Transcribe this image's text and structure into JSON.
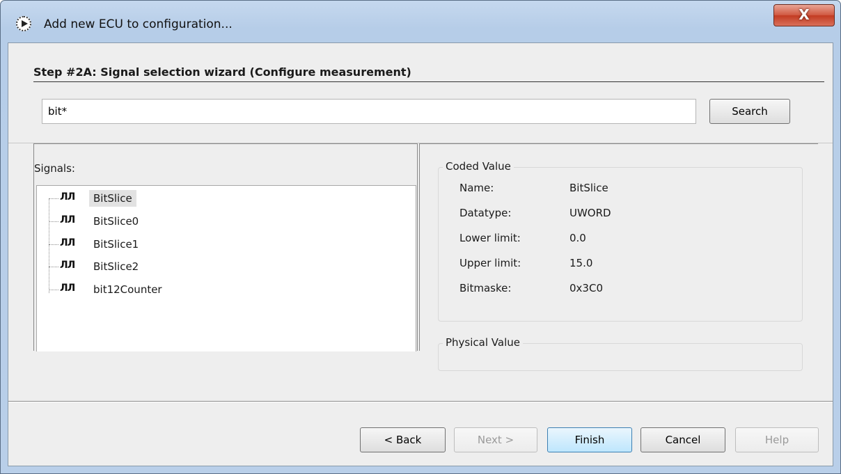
{
  "window": {
    "title": "Add new ECU to configuration...",
    "close_label": "X"
  },
  "step": {
    "title": "Step #2A: Signal selection wizard (Configure measurement)"
  },
  "search": {
    "value": "bit*",
    "button_label": "Search"
  },
  "signals": {
    "label": "Signals:",
    "icon": "signal-pulse-icon",
    "icon_glyph": "ЛЛ",
    "items": [
      {
        "label": "BitSlice",
        "selected": true
      },
      {
        "label": "BitSlice0"
      },
      {
        "label": "BitSlice1"
      },
      {
        "label": "BitSlice2"
      },
      {
        "label": "bit12Counter"
      }
    ]
  },
  "coded_value": {
    "legend": "Coded Value",
    "rows": [
      {
        "key": "Name:",
        "value": "BitSlice"
      },
      {
        "key": "Datatype:",
        "value": "UWORD"
      },
      {
        "key": "Lower limit:",
        "value": "0.0"
      },
      {
        "key": "Upper limit:",
        "value": "15.0"
      },
      {
        "key": "Bitmaske:",
        "value": "0x3C0"
      }
    ]
  },
  "physical_value": {
    "legend": "Physical Value"
  },
  "buttons": {
    "back": "< Back",
    "next": "Next >",
    "finish": "Finish",
    "cancel": "Cancel",
    "help": "Help"
  },
  "colors": {
    "title_bar": "#b9cfe9",
    "close_button": "#c23b22",
    "dialog_bg": "#eeeeee",
    "selection": "#e2e2e2"
  }
}
